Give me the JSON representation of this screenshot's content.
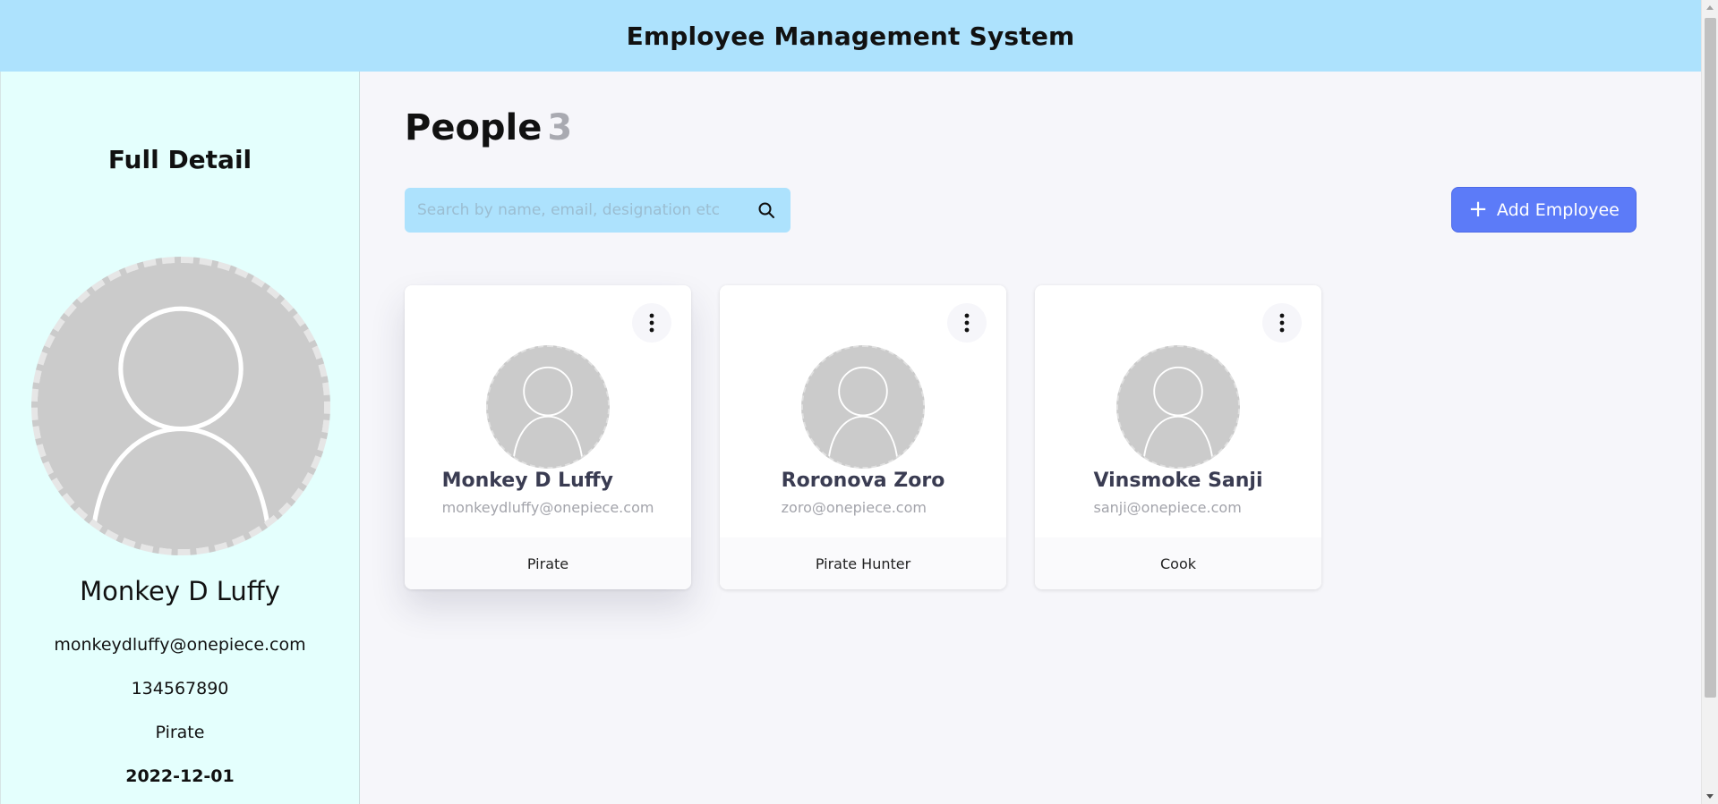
{
  "header": {
    "title": "Employee Management System"
  },
  "sidebar": {
    "title": "Full Detail",
    "name": "Monkey D Luffy",
    "email": "monkeydluffy@onepiece.com",
    "phone": "134567890",
    "designation": "Pirate",
    "date": "2022-12-01",
    "avatar_icon": "user-placeholder-icon"
  },
  "main": {
    "heading": "People",
    "count": "3",
    "search": {
      "placeholder": "Search by name, email, designation etc",
      "icon": "search-icon"
    },
    "add_button": {
      "label": "Add Employee",
      "icon": "plus-icon",
      "color": "#5c7bf8"
    }
  },
  "employees": [
    {
      "name": "Monkey D Luffy",
      "email": "monkeydluffy@onepiece.com",
      "designation": "Pirate",
      "selected": true
    },
    {
      "name": "Roronova Zoro",
      "email": "zoro@onepiece.com",
      "designation": "Pirate Hunter",
      "selected": false
    },
    {
      "name": "Vinsmoke Sanji",
      "email": "sanji@onepiece.com",
      "designation": "Cook",
      "selected": false
    }
  ],
  "colors": {
    "header_bg": "#ade2fd",
    "sidebar_bg": "#e4fffd",
    "page_bg": "#f6f6fa",
    "count_color": "#a9aab1"
  }
}
